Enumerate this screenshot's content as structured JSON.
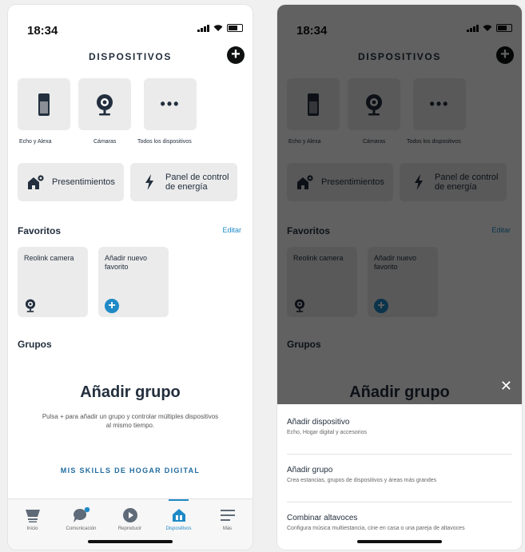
{
  "status": {
    "time": "18:34"
  },
  "header": {
    "title": "DISPOSITIVOS"
  },
  "categories": [
    {
      "label": "Echo y Alexa",
      "icon": "echo-speaker-icon"
    },
    {
      "label": "Cámaras",
      "icon": "camera-icon"
    },
    {
      "label": "Todos los dispositivos",
      "icon": "more-dots-icon"
    }
  ],
  "quick_actions": [
    {
      "label": "Presentimientos",
      "icon": "house-gear-icon"
    },
    {
      "label_line1": "Panel de control",
      "label_line2": "de energía",
      "icon": "lightning-icon"
    }
  ],
  "favorites": {
    "title": "Favoritos",
    "edit": "Editar",
    "items": [
      {
        "label": "Reolink camera",
        "icon": "camera-icon"
      },
      {
        "label_line1": "Añadir nuevo",
        "label_line2": "favorito",
        "icon": "plus-circle-icon"
      }
    ]
  },
  "groups": {
    "title": "Grupos",
    "add_title": "Añadir grupo",
    "add_desc": "Pulsa + para añadir un grupo y controlar múltiples dispositivos al mismo tiempo.",
    "skills_link": "MIS SKILLS DE HOGAR DIGITAL"
  },
  "tabs": [
    {
      "label": "Inicio",
      "icon": "home-icon",
      "active": false
    },
    {
      "label": "Comunicación",
      "icon": "chat-icon",
      "active": false
    },
    {
      "label": "Reproducir",
      "icon": "play-icon",
      "active": false
    },
    {
      "label": "Dispositivos",
      "icon": "devices-icon",
      "active": true
    },
    {
      "label": "Más",
      "icon": "menu-icon",
      "active": false
    }
  ],
  "sheet": {
    "items": [
      {
        "title": "Añadir dispositivo",
        "desc": "Echo, Hogar digital y accesorios"
      },
      {
        "title": "Añadir grupo",
        "desc": "Crea estancias, grupos de dispositivos y áreas más grandes"
      },
      {
        "title": "Combinar altavoces",
        "desc": "Configura música multiestancia, cine en casa o una pareja de altavoces"
      }
    ]
  },
  "colors": {
    "accent": "#1f8ac6",
    "active_tab": "#1f8ac6",
    "text": "#232f3e",
    "tile": "#ebebeb"
  }
}
